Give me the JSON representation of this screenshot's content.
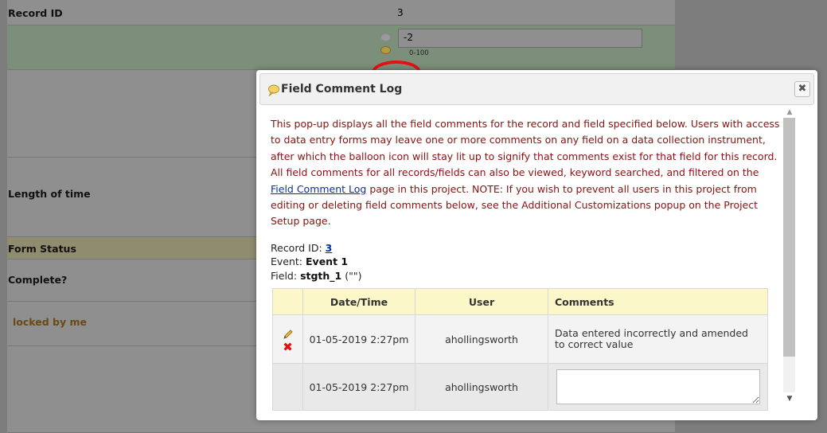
{
  "form": {
    "record_id_label": "Record ID",
    "record_id_value": "3",
    "field_value": "-2",
    "field_hint": "0-100",
    "length_label": "Length of time",
    "form_status_label": "Form Status",
    "complete_label": "Complete?",
    "locked_label": "locked by me"
  },
  "dialog": {
    "title": "Field Comment Log",
    "close_label": "✖",
    "intro_before_link": "This pop-up displays all the field comments for the record and field specified below. Users with access to data entry forms may leave one or more comments on any field on a data collection instrument, after which the balloon icon will stay lit up to signify that comments exist for that field for this record. All field comments for all records/fields can also be viewed, keyword searched, and filtered on the ",
    "intro_link": "Field Comment Log",
    "intro_after_link": " page in this project. NOTE: If you wish to prevent all users in this project from editing or deleting field comments below, see the Additional Customizations popup on the Project Setup page.",
    "record_label": "Record ID:",
    "record_value": "3",
    "event_label": "Event:",
    "event_value": "Event 1",
    "field_label": "Field:",
    "field_value": "stgth_1",
    "field_suffix": "(\"\")",
    "table": {
      "headers": [
        "",
        "Date/Time",
        "User",
        "Comments"
      ],
      "rows": [
        {
          "datetime": "01-05-2019 2:27pm",
          "user": "ahollingsworth",
          "comment": "Data entered incorrectly and amended to correct value"
        }
      ],
      "new_row": {
        "datetime": "01-05-2019 2:27pm",
        "user": "ahollingsworth"
      }
    }
  }
}
